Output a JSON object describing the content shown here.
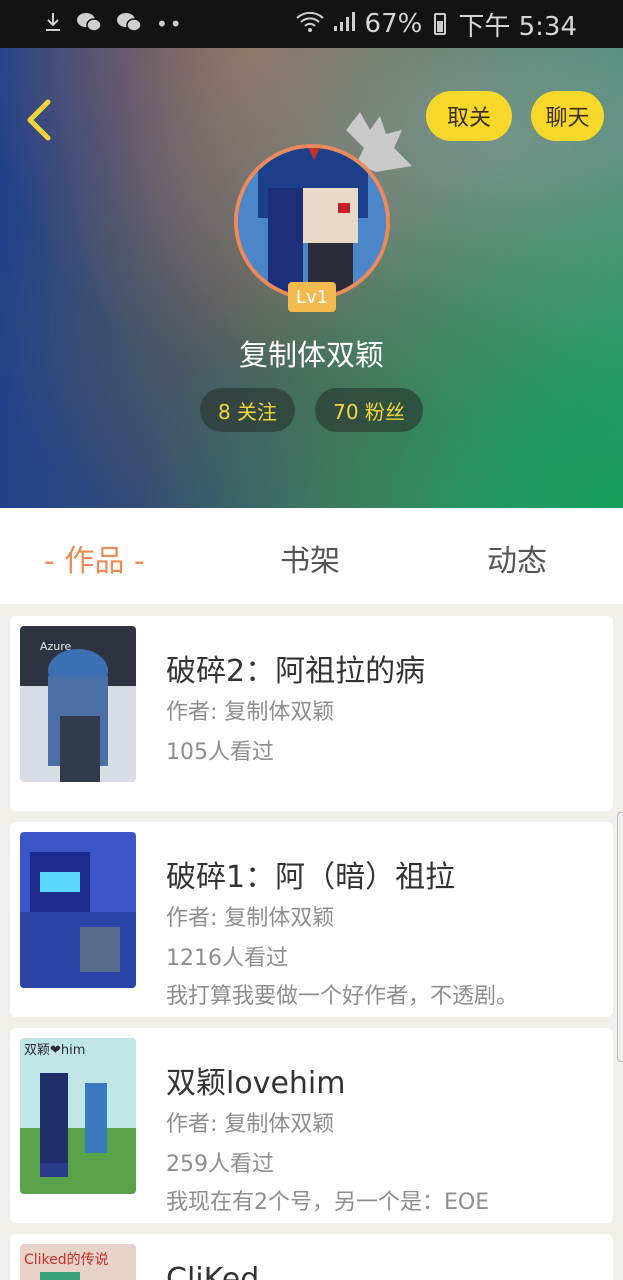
{
  "status_bar": {
    "battery": "67%",
    "time": "下午 5:34",
    "icons": [
      "download-icon",
      "wechat-icon",
      "wechat-icon",
      "more-dots-icon",
      "wifi-icon",
      "signal-icon",
      "battery-icon"
    ]
  },
  "header": {
    "unfollow_label": "取关",
    "chat_label": "聊天",
    "level": "Lv1",
    "username": "复制体双颖",
    "following": "8 关注",
    "fans": "70 粉丝"
  },
  "tabs": [
    {
      "label": "- 作品 -",
      "active": true
    },
    {
      "label": "书架",
      "active": false
    },
    {
      "label": "动态",
      "active": false
    }
  ],
  "works": [
    {
      "title": "破碎2：阿祖拉的病",
      "author": "作者: 复制体双颖",
      "views": "105人看过",
      "desc": "",
      "cover_text": "Azure"
    },
    {
      "title": "破碎1：阿（暗）祖拉",
      "author": "作者: 复制体双颖",
      "views": "1216人看过",
      "desc": "我打算我要做一个好作者，不透剧。",
      "cover_text": ""
    },
    {
      "title": "双颖lovehim",
      "author": "作者: 复制体双颖",
      "views": "259人看过",
      "desc": "我现在有2个号，另一个是：EOE",
      "cover_text": "双颖❤him"
    },
    {
      "title": "CliKed",
      "author": "",
      "views": "",
      "desc": "",
      "cover_text": "Cliked的传说"
    }
  ],
  "colors": {
    "accent": "#ef8a57",
    "button": "#f7d82a",
    "pill_text": "#f5d53a"
  }
}
